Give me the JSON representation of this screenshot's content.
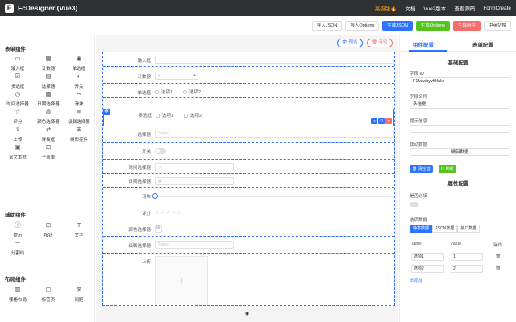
{
  "app": {
    "title": "FcDesigner (Vue3)",
    "logo_icon": "fc-logo-icon"
  },
  "nav": {
    "premium": "高级版🔥",
    "docs": "文档",
    "vue2": "Vue2版本",
    "source": "查看源码",
    "formcreate": "FormCreate",
    "premium_color": "#f5a623"
  },
  "toolbar": {
    "import_json": "导入JSON",
    "import_options": "导入Options",
    "gen_json": "生成JSON",
    "gen_options": "生成Options",
    "gen_component": "生成组件",
    "lang_switch": "中英切换",
    "colors": {
      "primary": "#2e73ff",
      "success": "#52c41a",
      "danger": "#f56c6c"
    }
  },
  "left": {
    "groups": [
      {
        "title": "表单组件",
        "items": [
          {
            "label": "输入框",
            "icon": "▭"
          },
          {
            "label": "计数器",
            "icon": "▦"
          },
          {
            "label": "单选框",
            "icon": "◉"
          },
          {
            "label": "多选框",
            "icon": "☑"
          },
          {
            "label": "选择器",
            "icon": "▤"
          },
          {
            "label": "开关",
            "icon": "◐"
          },
          {
            "label": "时间选择器",
            "icon": "◷"
          },
          {
            "label": "日期选择器",
            "icon": "▦"
          },
          {
            "label": "滑块",
            "icon": "⊸"
          },
          {
            "label": "评分",
            "icon": "☆"
          },
          {
            "label": "颜色选择器",
            "icon": "◍"
          },
          {
            "label": "级联选择器",
            "icon": "≡"
          },
          {
            "label": "上传",
            "icon": "⇧"
          },
          {
            "label": "穿梭框",
            "icon": "⇄"
          },
          {
            "label": "树形控件",
            "icon": "⊞"
          },
          {
            "label": "富文本框",
            "icon": "▣"
          },
          {
            "label": "子表单",
            "icon": "⊟"
          }
        ]
      },
      {
        "title": "辅助组件",
        "items": [
          {
            "label": "提示",
            "icon": "ⓘ"
          },
          {
            "label": "按钮",
            "icon": "⊡"
          },
          {
            "label": "文字",
            "icon": "T"
          },
          {
            "label": "分割线",
            "icon": "─"
          }
        ]
      },
      {
        "title": "布局组件",
        "items": [
          {
            "label": "栅格布局",
            "icon": "▥"
          },
          {
            "label": "标签页",
            "icon": "▢"
          },
          {
            "label": "间距",
            "icon": "⊠"
          }
        ]
      }
    ]
  },
  "canvas": {
    "preview": "👁 预览",
    "clear": "🗑 清空",
    "rows": {
      "input": {
        "label": "输入框"
      },
      "counter": {
        "label": "计数器",
        "minus": "−",
        "plus": "+"
      },
      "radio": {
        "label": "单选框",
        "options": [
          "选项1",
          "选项2"
        ]
      },
      "checkbox": {
        "label": "多选框",
        "options": [
          "选项1",
          "选项2"
        ],
        "handle": "✥"
      },
      "select": {
        "label": "选择器",
        "placeholder": "Select",
        "arrow": "⌄"
      },
      "switch": {
        "label": "开关"
      },
      "time": {
        "label": "时间选择器",
        "icon": "◷"
      },
      "date": {
        "label": "日期选择器",
        "icon": "▦"
      },
      "slider": {
        "label": "滑块"
      },
      "rate": {
        "label": "评分",
        "stars": "☆☆☆☆☆"
      },
      "color": {
        "label": "颜色选择器",
        "icon": "⊞"
      },
      "cascader": {
        "label": "级联选择器",
        "placeholder": "Select"
      },
      "upload": {
        "label": "上传",
        "arrow": "↑"
      }
    },
    "tools": [
      "↗",
      "❐",
      "✕"
    ],
    "footer_icon": "github-icon",
    "footer_glyph": "◉"
  },
  "right": {
    "tabs": [
      "组件配置",
      "表单配置"
    ],
    "basic_title": "基础配置",
    "field_id_label": "字段 ID",
    "field_id_value": "F1falwhyvf0fakc",
    "field_name_label": "字段名称",
    "field_name_value": "多选框",
    "hint_label": "提示信息",
    "hint_value": "",
    "linkage_label": "联动数据",
    "linkage_button": "编辑数据",
    "clear_btn": "🗑 清空值",
    "refresh_btn": "⟳ 刷新",
    "attr_title": "属性配置",
    "required_label": "是否必填",
    "options_label": "选项数据",
    "data_tabs": [
      "静态数据",
      "JSON数据",
      "接口数据"
    ],
    "table_headers": [
      "label",
      "value",
      "操作"
    ],
    "options": [
      {
        "label": "选项1",
        "value": "1"
      },
      {
        "label": "选项2",
        "value": "2"
      }
    ],
    "trash_icon": "🗑",
    "add": "⊕添加"
  }
}
